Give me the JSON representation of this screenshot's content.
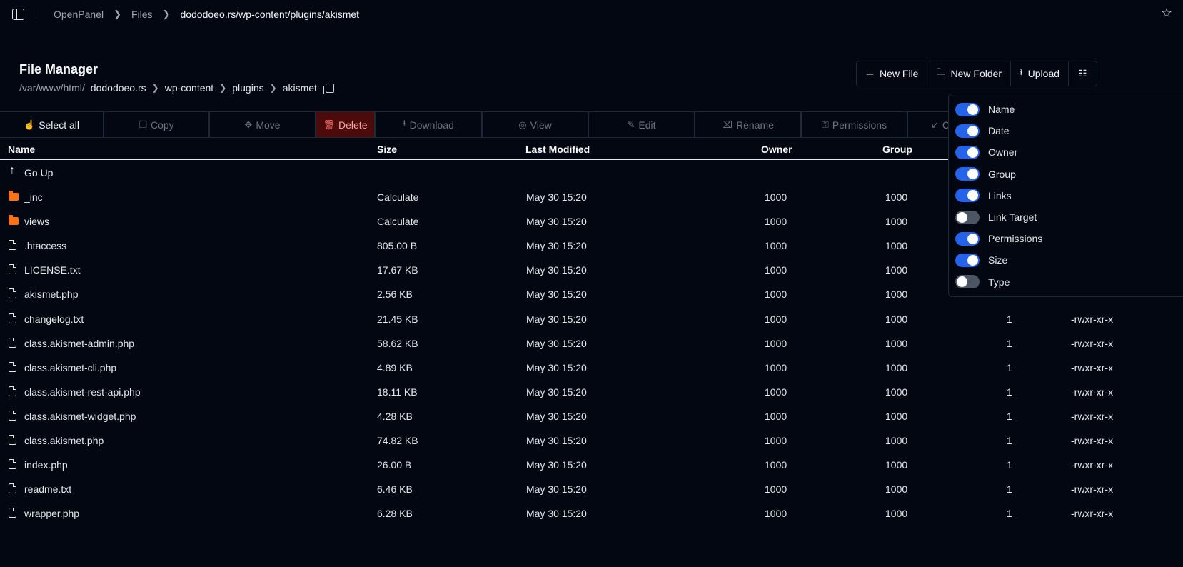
{
  "breadcrumb": [
    "OpenPanel",
    "Files",
    "dododoeo.rs/wp-content/plugins/akismet"
  ],
  "title": "File Manager",
  "path": {
    "root": "/var/www/html/",
    "segments": [
      "dododoeo.rs",
      "wp-content",
      "plugins",
      "akismet"
    ]
  },
  "actions": {
    "new_file": "New File",
    "new_folder": "New Folder",
    "upload": "Upload"
  },
  "toolbar": {
    "select_all": "Select all",
    "copy": "Copy",
    "move": "Move",
    "delete": "Delete",
    "download": "Download",
    "view": "View",
    "edit": "Edit",
    "rename": "Rename",
    "permissions": "Permissions",
    "compress_partial": "C"
  },
  "columns": {
    "name": "Name",
    "size": "Size",
    "modified": "Last Modified",
    "owner": "Owner",
    "group": "Group"
  },
  "go_up": "Go Up",
  "files": [
    {
      "name": "_inc",
      "type": "folder",
      "size": "Calculate",
      "modified": "May 30 15:20",
      "owner": "1000",
      "group": "1000",
      "links": "",
      "perms": ""
    },
    {
      "name": "views",
      "type": "folder",
      "size": "Calculate",
      "modified": "May 30 15:20",
      "owner": "1000",
      "group": "1000",
      "links": "",
      "perms": ""
    },
    {
      "name": ".htaccess",
      "type": "file",
      "size": "805.00 B",
      "modified": "May 30 15:20",
      "owner": "1000",
      "group": "1000",
      "links": "",
      "perms": ""
    },
    {
      "name": "LICENSE.txt",
      "type": "file",
      "size": "17.67 KB",
      "modified": "May 30 15:20",
      "owner": "1000",
      "group": "1000",
      "links": "",
      "perms": ""
    },
    {
      "name": "akismet.php",
      "type": "file",
      "size": "2.56 KB",
      "modified": "May 30 15:20",
      "owner": "1000",
      "group": "1000",
      "links": "",
      "perms": ""
    },
    {
      "name": "changelog.txt",
      "type": "file",
      "size": "21.45 KB",
      "modified": "May 30 15:20",
      "owner": "1000",
      "group": "1000",
      "links": "1",
      "perms": "-rwxr-xr-x"
    },
    {
      "name": "class.akismet-admin.php",
      "type": "file",
      "size": "58.62 KB",
      "modified": "May 30 15:20",
      "owner": "1000",
      "group": "1000",
      "links": "1",
      "perms": "-rwxr-xr-x"
    },
    {
      "name": "class.akismet-cli.php",
      "type": "file",
      "size": "4.89 KB",
      "modified": "May 30 15:20",
      "owner": "1000",
      "group": "1000",
      "links": "1",
      "perms": "-rwxr-xr-x"
    },
    {
      "name": "class.akismet-rest-api.php",
      "type": "file",
      "size": "18.11 KB",
      "modified": "May 30 15:20",
      "owner": "1000",
      "group": "1000",
      "links": "1",
      "perms": "-rwxr-xr-x"
    },
    {
      "name": "class.akismet-widget.php",
      "type": "file",
      "size": "4.28 KB",
      "modified": "May 30 15:20",
      "owner": "1000",
      "group": "1000",
      "links": "1",
      "perms": "-rwxr-xr-x"
    },
    {
      "name": "class.akismet.php",
      "type": "file",
      "size": "74.82 KB",
      "modified": "May 30 15:20",
      "owner": "1000",
      "group": "1000",
      "links": "1",
      "perms": "-rwxr-xr-x"
    },
    {
      "name": "index.php",
      "type": "file",
      "size": "26.00 B",
      "modified": "May 30 15:20",
      "owner": "1000",
      "group": "1000",
      "links": "1",
      "perms": "-rwxr-xr-x"
    },
    {
      "name": "readme.txt",
      "type": "file",
      "size": "6.46 KB",
      "modified": "May 30 15:20",
      "owner": "1000",
      "group": "1000",
      "links": "1",
      "perms": "-rwxr-xr-x"
    },
    {
      "name": "wrapper.php",
      "type": "file",
      "size": "6.28 KB",
      "modified": "May 30 15:20",
      "owner": "1000",
      "group": "1000",
      "links": "1",
      "perms": "-rwxr-xr-x"
    }
  ],
  "column_toggles": [
    {
      "label": "Name",
      "on": true
    },
    {
      "label": "Date",
      "on": true
    },
    {
      "label": "Owner",
      "on": true
    },
    {
      "label": "Group",
      "on": true
    },
    {
      "label": "Links",
      "on": true
    },
    {
      "label": "Link Target",
      "on": false
    },
    {
      "label": "Permissions",
      "on": true
    },
    {
      "label": "Size",
      "on": true
    },
    {
      "label": "Type",
      "on": false
    }
  ],
  "colors": {
    "background": "#030712",
    "accent": "#2563eb",
    "folder": "#f97316",
    "delete_bg": "#4c0a0a"
  }
}
